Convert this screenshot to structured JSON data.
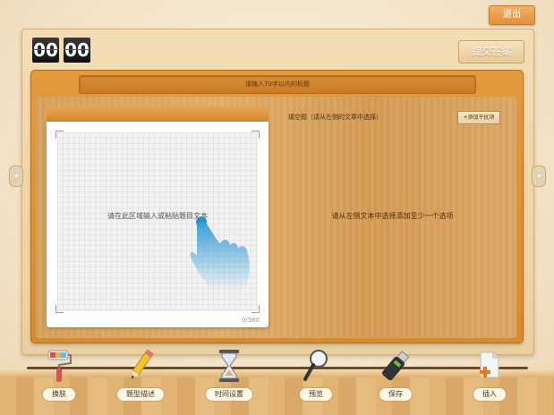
{
  "header": {
    "exit_label": "退出",
    "submit_label": "提交答案"
  },
  "timer": {
    "minutes": "00",
    "seconds": "00"
  },
  "editor": {
    "title_placeholder": "请输入70字以内的标题",
    "input_hint": "请在此区域输入或粘贴题目文本",
    "char_counter": "0/360"
  },
  "blanks": {
    "label": "填空题（请从左侧的文章中选择）",
    "add_option_label": "+添加干扰项",
    "empty_hint": "请从左侧文本中选择添加至少一个选项"
  },
  "toolbar": {
    "items": [
      {
        "label": "换肤",
        "icon": "paint-roller-icon"
      },
      {
        "label": "题型描述",
        "icon": "pencil-icon"
      },
      {
        "label": "时间设置",
        "icon": "hourglass-icon"
      },
      {
        "label": "预览",
        "icon": "magnifier-icon"
      },
      {
        "label": "保存",
        "icon": "usb-drive-icon"
      },
      {
        "label": "插入",
        "icon": "insert-document-icon"
      }
    ]
  },
  "colors": {
    "accent": "#e0913a",
    "wood": "#d7a25e",
    "frame": "#d88b2c"
  }
}
